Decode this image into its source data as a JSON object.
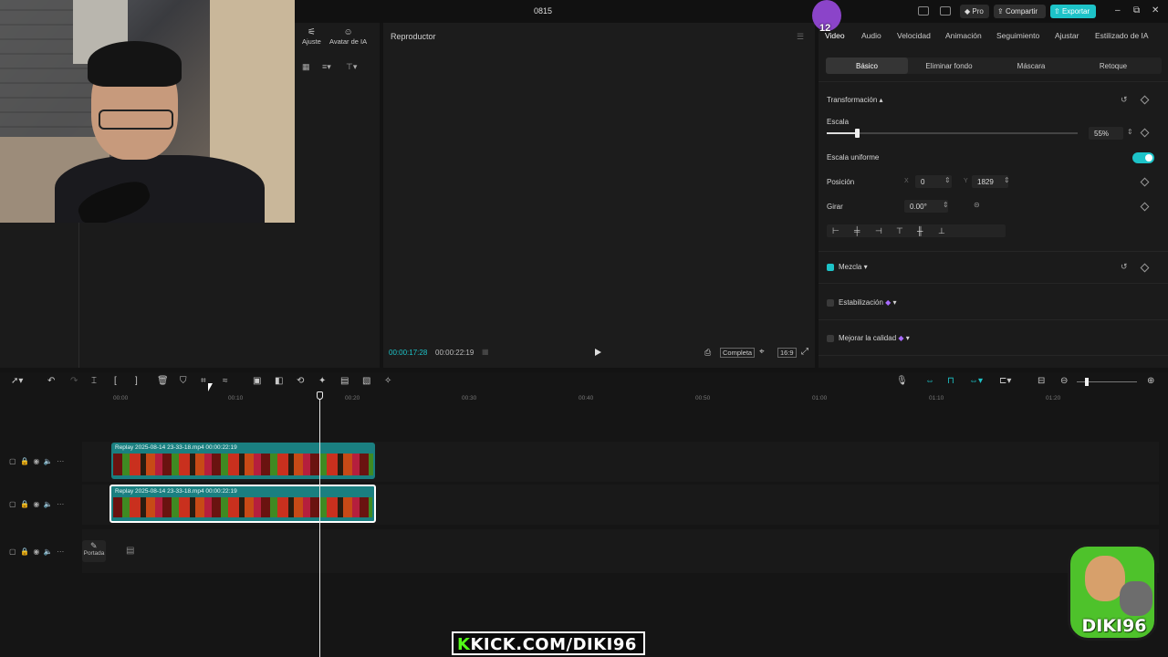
{
  "app": {
    "title": "0815"
  },
  "titlebar": {
    "pro_label": "Pro",
    "share_label": "Compartir",
    "export_label": "Exportar",
    "minimize": "–",
    "maximize": "⧉",
    "close": "✕"
  },
  "media_panel": {
    "tools": [
      {
        "icon": "adjust-icon",
        "label": "Ajuste"
      },
      {
        "icon": "ai-avatar-icon",
        "label": "Avatar de IA"
      }
    ]
  },
  "player": {
    "title": "Reproductor",
    "current_time": "00:00:17:28",
    "total_time": "00:00:22:19",
    "quality_label": "Completa",
    "ratio_label": "16:9"
  },
  "inspector": {
    "tabs": [
      "Video",
      "Audio",
      "Velocidad",
      "Animación",
      "Seguimiento",
      "Ajustar",
      "Estilizado de IA"
    ],
    "active_tab": "Video",
    "subtabs": [
      "Básico",
      "Eliminar fondo",
      "Máscara",
      "Retoque"
    ],
    "active_subtab": "Básico",
    "transform_label": "Transformación",
    "scale_label": "Escala",
    "scale_value": "55%",
    "scale_fraction": 0.12,
    "uniform_scale_label": "Escala uniforme",
    "uniform_scale_on": true,
    "position_label": "Posición",
    "pos_x_label": "X",
    "pos_x": "0",
    "pos_y_label": "Y",
    "pos_y": "1829",
    "rotate_label": "Girar",
    "rotate_value": "0.00°",
    "blend_label": "Mezcla",
    "blend_on": true,
    "stabilize_label": "Estabilización",
    "stabilize_on": false,
    "enhance_label": "Mejorar la calidad",
    "enhance_on": false
  },
  "timeline": {
    "ruler": [
      "00:00",
      "00:10",
      "00:20",
      "00:30",
      "00:40",
      "00:50",
      "01:00",
      "01:10",
      "01:20"
    ],
    "clips": [
      {
        "label": "Replay 2025-08-14 23-33-18.mp4   00:00:22:19",
        "selected": false
      },
      {
        "label": "Replay 2025-08-14 23-33-18.mp4   00:00:22:19",
        "selected": true
      }
    ],
    "cover_label": "Portada"
  },
  "overlays": {
    "kick_k": "K",
    "kick_text": "KICK.COM/DIKI96",
    "logo_text": "DIKI96",
    "alert_number": "12"
  },
  "colors": {
    "accent": "#1dc3c8",
    "clip": "#1a7f80",
    "kick_green": "#53fc18"
  }
}
